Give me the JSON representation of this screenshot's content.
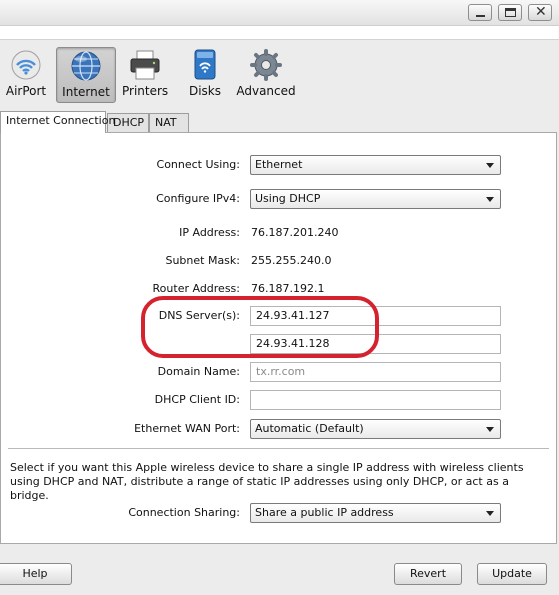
{
  "window": {
    "close_glyph": "✕"
  },
  "toolbar": {
    "items": [
      {
        "label": "AirPort",
        "icon": "wifi-icon"
      },
      {
        "label": "Internet",
        "icon": "globe-icon",
        "active": true
      },
      {
        "label": "Printers",
        "icon": "printer-icon"
      },
      {
        "label": "Disks",
        "icon": "disk-icon"
      },
      {
        "label": "Advanced",
        "icon": "gear-icon"
      }
    ]
  },
  "tabs": [
    {
      "label": "Internet Connection",
      "active": true
    },
    {
      "label": "DHCP"
    },
    {
      "label": "NAT"
    }
  ],
  "form": {
    "connect_using": {
      "label": "Connect Using:",
      "value": "Ethernet"
    },
    "configure_ipv4": {
      "label": "Configure IPv4:",
      "value": "Using DHCP"
    },
    "ip_address": {
      "label": "IP Address:",
      "value": "76.187.201.240"
    },
    "subnet_mask": {
      "label": "Subnet Mask:",
      "value": "255.255.240.0"
    },
    "router_address": {
      "label": "Router Address:",
      "value": "76.187.192.1"
    },
    "dns_servers": {
      "label": "DNS Server(s):",
      "primary": "24.93.41.127",
      "secondary": "24.93.41.128"
    },
    "domain_name": {
      "label": "Domain Name:",
      "placeholder": "tx.rr.com"
    },
    "dhcp_client_id": {
      "label": "DHCP Client ID:",
      "value": ""
    },
    "ethernet_wan_port": {
      "label": "Ethernet WAN Port:",
      "value": "Automatic (Default)"
    },
    "description": "Select if you want this Apple wireless device to share a single IP address with wireless clients using DHCP and NAT, distribute a range of static IP addresses using only DHCP, or act as a bridge.",
    "connection_sharing": {
      "label": "Connection Sharing:",
      "value": "Share a public IP address"
    }
  },
  "colors": {
    "highlight_ring": "#d4232f"
  },
  "buttons": {
    "help": "Help",
    "revert": "Revert",
    "update": "Update"
  }
}
